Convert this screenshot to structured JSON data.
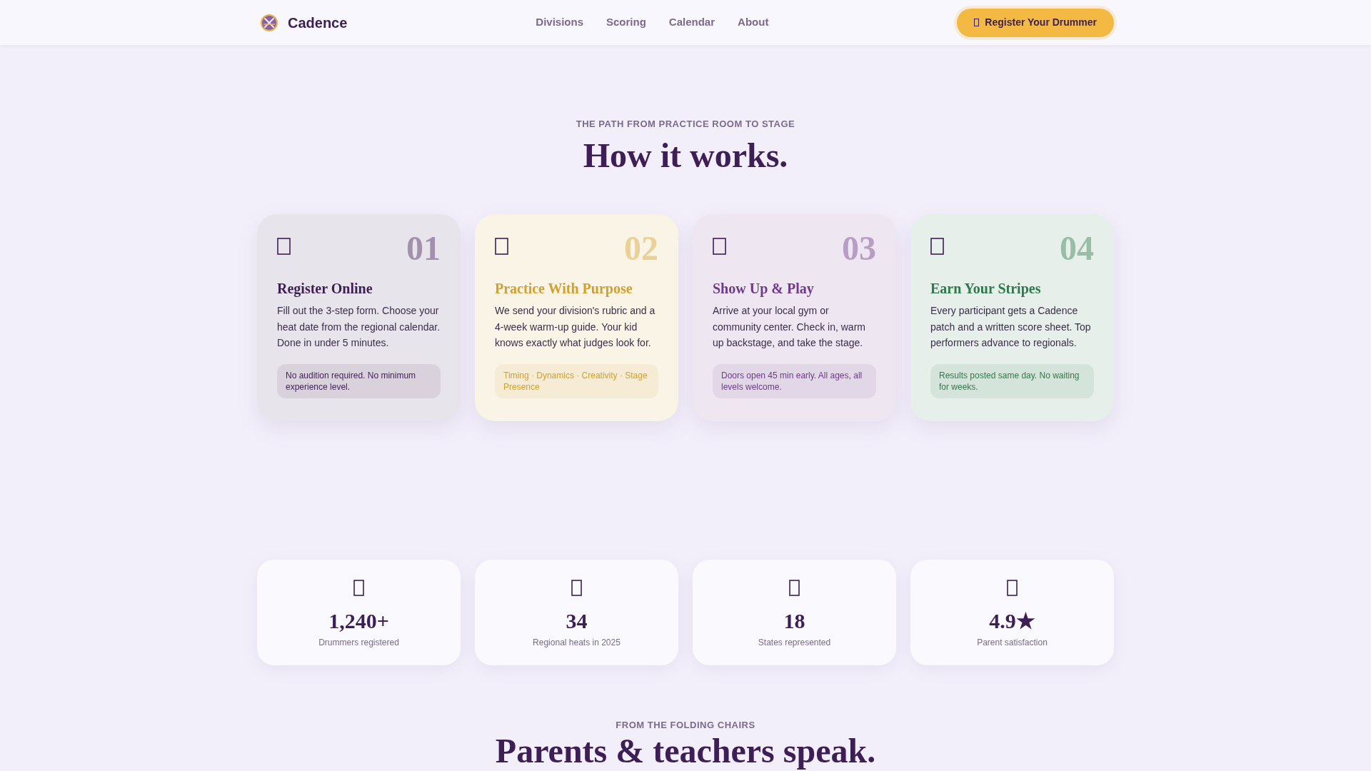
{
  "header": {
    "brand": "Cadence",
    "nav": [
      "Divisions",
      "Scoring",
      "Calendar",
      "About"
    ],
    "cta": "Register Your Drummer"
  },
  "how_it_works": {
    "eyebrow": "THE PATH FROM PRACTICE ROOM TO STAGE",
    "title": "How it works.",
    "steps": [
      {
        "number": "01",
        "title": "Register Online",
        "text": "Fill out the 3-step form. Choose your heat date from the regional calendar. Done in under 5 minutes.",
        "note": "No audition required. No minimum experience level.",
        "color": "#3d1f56"
      },
      {
        "number": "02",
        "title": "Practice With Purpose",
        "text": "We send your division's rubric and a 4-week warm-up guide. Your kid knows exactly what judges look for.",
        "note": "Timing · Dynamics · Creativity · Stage Presence",
        "color": "#d4a02c"
      },
      {
        "number": "03",
        "title": "Show Up & Play",
        "text": "Arrive at your local gym or community center. Check in, warm up backstage, and take the stage.",
        "note": "Doors open 45 min early. All ages, all levels welcome.",
        "color": "#6e3a8a"
      },
      {
        "number": "04",
        "title": "Earn Your Stripes",
        "text": "Every participant gets a Cadence patch and a written score sheet. Top performers advance to regionals.",
        "note": "Results posted same day. No waiting for weeks.",
        "color": "#2f7a4a"
      }
    ]
  },
  "stats": [
    {
      "value": "1,240+",
      "label": "Drummers registered"
    },
    {
      "value": "34",
      "label": "Regional heats in 2025"
    },
    {
      "value": "18",
      "label": "States represented"
    },
    {
      "value": "4.9★",
      "label": "Parent satisfaction"
    }
  ],
  "testimonials": {
    "eyebrow": "FROM THE FOLDING CHAIRS",
    "title": "Parents & teachers speak."
  }
}
